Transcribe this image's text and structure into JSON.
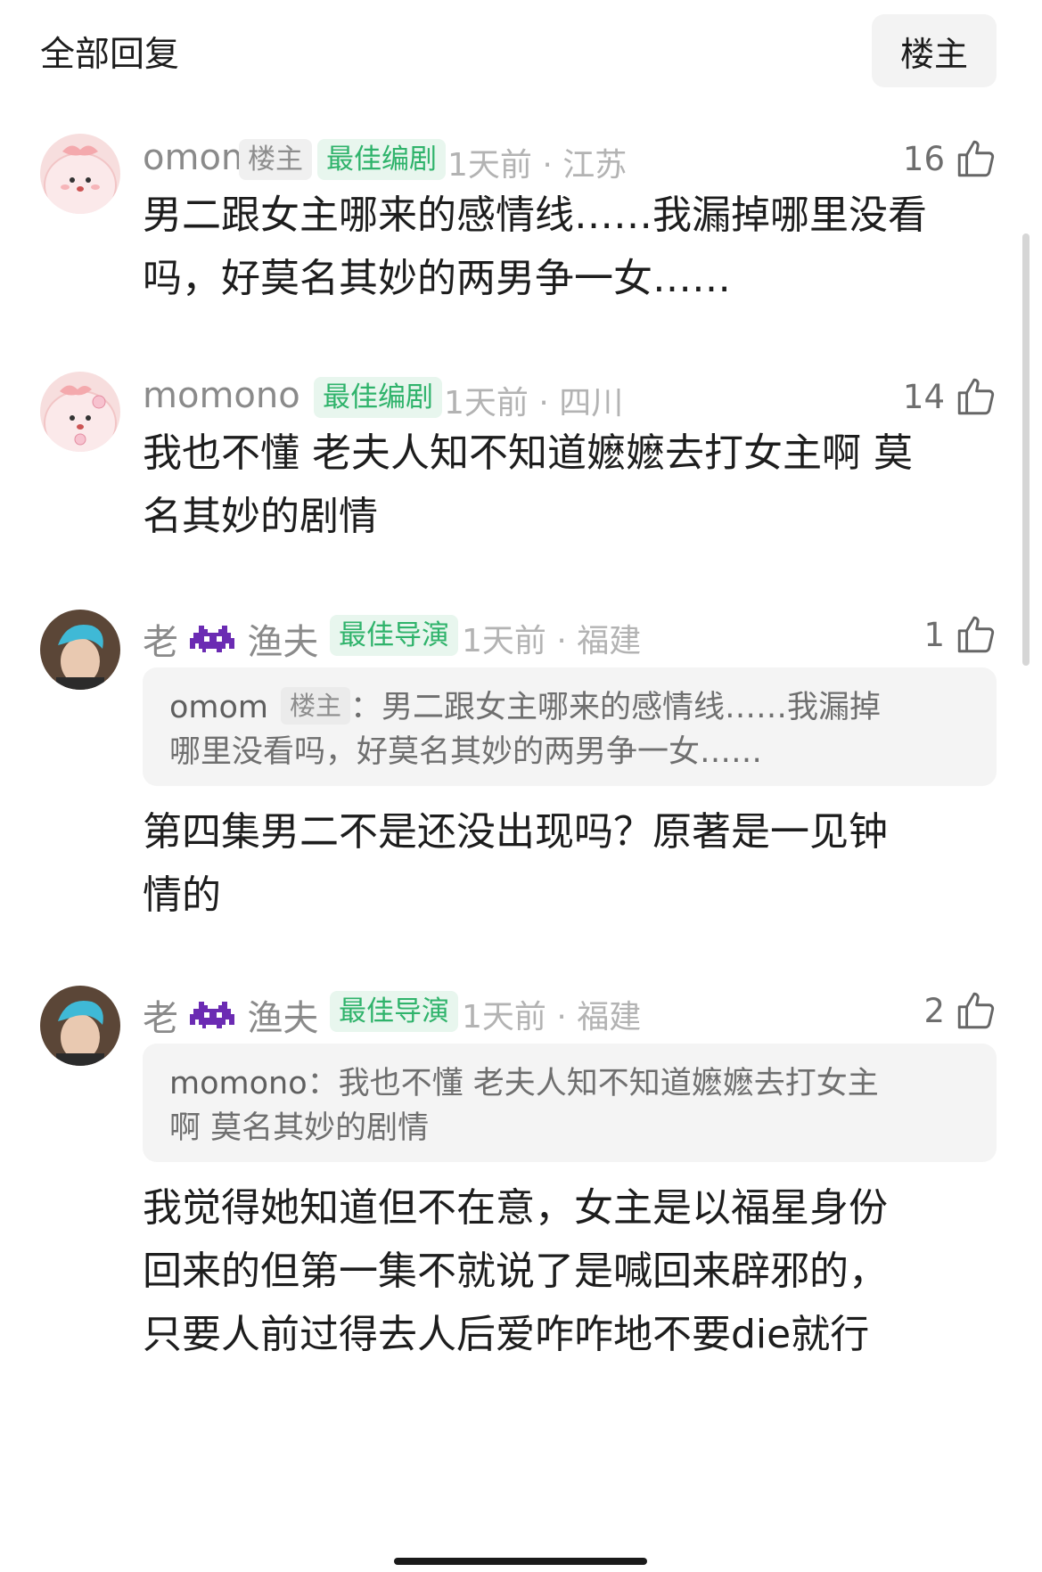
{
  "header": {
    "title": "全部回复",
    "filter_label": "楼主"
  },
  "comments": [
    {
      "username": "omom",
      "op_badge": "楼主",
      "badge": "最佳编剧",
      "time_location": "1天前 · 江苏",
      "likes": "16",
      "text_lines": [
        "男二跟女主哪来的感情线……我漏掉哪里没看",
        "吗，好莫名其妙的两男争一女……"
      ]
    },
    {
      "username": "momono",
      "badge": "最佳编剧",
      "time_location": "1天前 · 四川",
      "likes": "14",
      "text_lines": [
        "我也不懂 老夫人知不知道嬷嬷去打女主啊 莫",
        "名其妙的剧情"
      ]
    },
    {
      "username_prefix": "老",
      "username_suffix": "渔夫",
      "badge": "最佳导演",
      "time_location": "1天前 · 福建",
      "likes": "1",
      "quote_user": "omom",
      "quote_op_badge": "楼主",
      "quote_lines": [
        "：男二跟女主哪来的感情线……我漏掉",
        "哪里没看吗，好莫名其妙的两男争一女……"
      ],
      "text_lines": [
        "第四集男二不是还没出现吗？原著是一见钟",
        "情的"
      ]
    },
    {
      "username_prefix": "老",
      "username_suffix": "渔夫",
      "badge": "最佳导演",
      "time_location": "1天前 · 福建",
      "likes": "2",
      "quote_user": "momono",
      "quote_lines": [
        "：我也不懂 老夫人知不知道嬷嬷去打女主",
        "啊 莫名其妙的剧情"
      ],
      "text_lines": [
        "我觉得她知道但不在意，女主是以福星身份",
        "回来的但第一集不就说了是喊回来辟邪的，",
        "只要人前过得去人后爱咋咋地不要die就行"
      ]
    }
  ],
  "icons": {
    "like": "thumbs-up-icon",
    "emoji": "space-invader-icon"
  },
  "colors": {
    "badge_green": "#2fb36b",
    "badge_green_bg": "#e8f6ee",
    "meta_gray": "#b3b3b3"
  }
}
